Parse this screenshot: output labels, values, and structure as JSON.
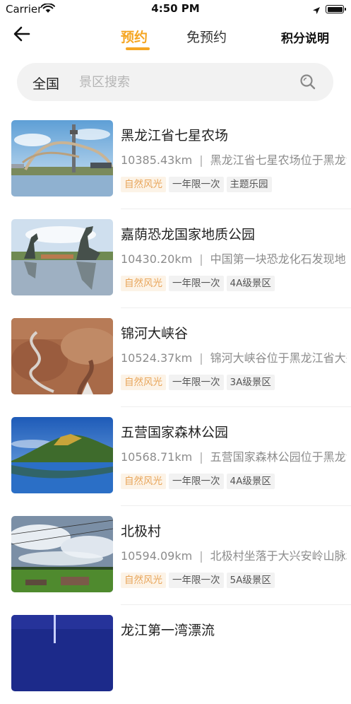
{
  "status_bar": {
    "carrier": "Carrier",
    "time": "4:50 PM"
  },
  "nav": {
    "tabs": [
      {
        "label": "预约",
        "active": true
      },
      {
        "label": "免预约",
        "active": false
      }
    ],
    "points_label": "积分说明"
  },
  "search": {
    "region": "全国",
    "placeholder": "景区搜索"
  },
  "colors": {
    "accent": "#f5a623",
    "tag_orange_text": "#e8a55a",
    "tag_orange_bg": "#fcf3e7"
  },
  "items": [
    {
      "title": "黑龙江省七星农场",
      "distance": "10385.43km",
      "desc": "黑龙江省七星农场位于黑龙江省三江平原腹地",
      "tags": [
        "自然风光",
        "一年限一次",
        "主题乐园"
      ]
    },
    {
      "title": "嘉荫恐龙国家地质公园",
      "distance": "10430.20km",
      "desc": "中国第一块恐龙化石发现地",
      "tags": [
        "自然风光",
        "一年限一次",
        "4A级景区"
      ]
    },
    {
      "title": "锦河大峡谷",
      "distance": "10524.37km",
      "desc": "锦河大峡谷位于黑龙江省大兴安岭地区",
      "tags": [
        "自然风光",
        "一年限一次",
        "3A级景区"
      ]
    },
    {
      "title": "五营国家森林公园",
      "distance": "10568.71km",
      "desc": "五营国家森林公园位于黑龙江省伊春市",
      "tags": [
        "自然风光",
        "一年限一次",
        "4A级景区"
      ]
    },
    {
      "title": "北极村",
      "distance": "10594.09km",
      "desc": "北极村坐落于大兴安岭山脉北麓",
      "tags": [
        "自然风光",
        "一年限一次",
        "5A级景区"
      ]
    },
    {
      "title": "龙江第一湾漂流",
      "distance": "",
      "desc": "",
      "tags": []
    }
  ]
}
